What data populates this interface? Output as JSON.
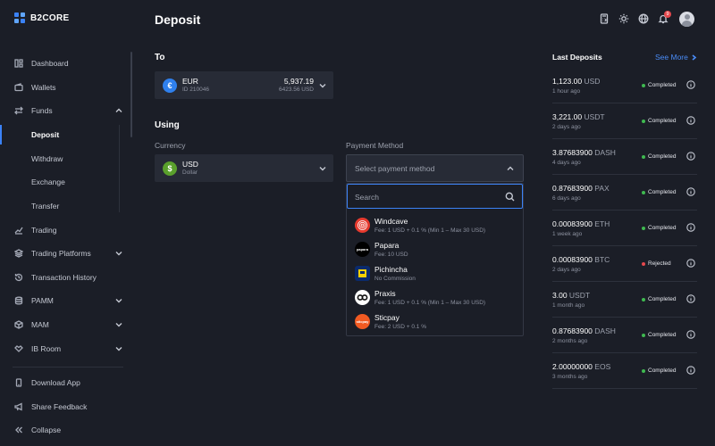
{
  "brand": {
    "name": "B2CORE"
  },
  "header": {
    "title": "Deposit",
    "notification_count": "9"
  },
  "sidebar": {
    "items": [
      {
        "label": "Dashboard",
        "icon": "dashboard-icon"
      },
      {
        "label": "Wallets",
        "icon": "wallet-icon"
      },
      {
        "label": "Funds",
        "icon": "transfer-arrows-icon"
      },
      {
        "label": "Trading",
        "icon": "chart-line-icon"
      },
      {
        "label": "Trading Platforms",
        "icon": "layers-icon"
      },
      {
        "label": "Transaction History",
        "icon": "history-icon"
      },
      {
        "label": "PAMM",
        "icon": "database-icon"
      },
      {
        "label": "MAM",
        "icon": "box-icon"
      },
      {
        "label": "IB Room",
        "icon": "handshake-icon"
      }
    ],
    "funds_sub": [
      "Deposit",
      "Withdraw",
      "Exchange",
      "Transfer"
    ],
    "bottom": [
      {
        "label": "Download App",
        "icon": "phone-icon"
      },
      {
        "label": "Share Feedback",
        "icon": "megaphone-icon"
      },
      {
        "label": "Collapse",
        "icon": "double-chevron-left-icon"
      }
    ]
  },
  "to": {
    "section_label": "To",
    "account": {
      "currency": "EUR",
      "id": "ID 210046",
      "balance": "5,937.19",
      "balance_usd": "6423.56 USD",
      "symbol": "€"
    }
  },
  "using": {
    "section_label": "Using",
    "currency_label": "Currency",
    "currency": {
      "code": "USD",
      "name": "Dollar",
      "symbol": "$"
    },
    "payment_label": "Payment Method",
    "payment_placeholder": "Select payment method",
    "search_placeholder": "Search",
    "methods": [
      {
        "name": "Windcave",
        "fee": "Fee: 1 USD + 0.1 % (Min 1 – Max 30 USD)",
        "logo": "windcave-logo",
        "logo_text": "",
        "color": "#e63a2e"
      },
      {
        "name": "Papara",
        "fee": "Fee: 10 USD",
        "logo": "papara-logo",
        "logo_text": "papara",
        "color": "#000000"
      },
      {
        "name": "Pichincha",
        "fee": "No Commission",
        "logo": "pichincha-logo",
        "logo_text": "",
        "color": "#0a2a6b"
      },
      {
        "name": "Praxis",
        "fee": "Fee: 1 USD + 0.1 % (Min 1 – Max 30 USD)",
        "logo": "praxis-logo",
        "logo_text": "",
        "color": "#ffffff"
      },
      {
        "name": "Sticpay",
        "fee": "Fee: 2 USD + 0.1 %",
        "logo": "sticpay-logo",
        "logo_text": "sticpay",
        "color": "#f05a22"
      }
    ]
  },
  "last_deposits": {
    "title": "Last Deposits",
    "see_more": "See More",
    "items": [
      {
        "amount": "1,123.00",
        "currency": "USD",
        "time": "1 hour ago",
        "status": "Completed",
        "status_color": "#3fb950"
      },
      {
        "amount": "3,221.00",
        "currency": "USDT",
        "time": "2 days ago",
        "status": "Completed",
        "status_color": "#3fb950"
      },
      {
        "amount": "3.87683900",
        "currency": "DASH",
        "time": "4 days ago",
        "status": "Completed",
        "status_color": "#3fb950"
      },
      {
        "amount": "0.87683900",
        "currency": "PAX",
        "time": "6 days ago",
        "status": "Completed",
        "status_color": "#3fb950"
      },
      {
        "amount": "0.00083900",
        "currency": "ETH",
        "time": "1 week ago",
        "status": "Completed",
        "status_color": "#3fb950"
      },
      {
        "amount": "0.00083900",
        "currency": "BTC",
        "time": "2 days ago",
        "status": "Rejected",
        "status_color": "#e5484d"
      },
      {
        "amount": "3.00",
        "currency": "USDT",
        "time": "1 month ago",
        "status": "Completed",
        "status_color": "#3fb950"
      },
      {
        "amount": "0.87683900",
        "currency": "DASH",
        "time": "2 months ago",
        "status": "Completed",
        "status_color": "#3fb950"
      },
      {
        "amount": "2.00000000",
        "currency": "EOS",
        "time": "3 months ago",
        "status": "Completed",
        "status_color": "#3fb950"
      }
    ]
  }
}
